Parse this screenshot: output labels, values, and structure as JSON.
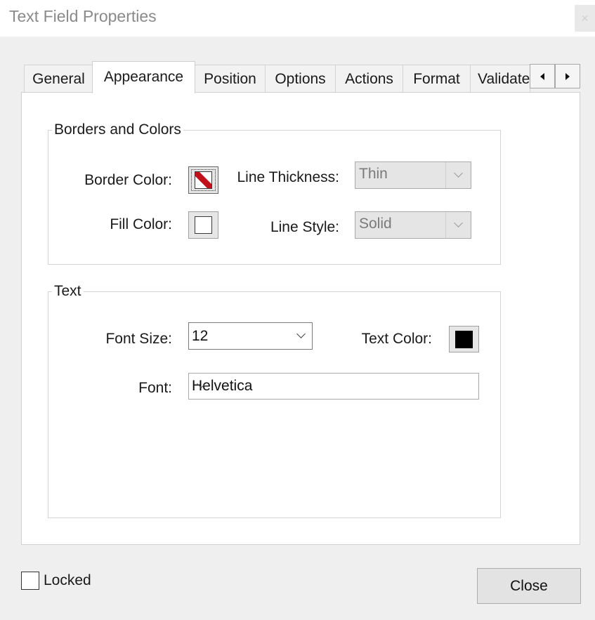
{
  "window": {
    "title": "Text Field Properties"
  },
  "tabs": [
    {
      "label": "General",
      "active": false
    },
    {
      "label": "Appearance",
      "active": true
    },
    {
      "label": "Position",
      "active": false
    },
    {
      "label": "Options",
      "active": false
    },
    {
      "label": "Actions",
      "active": false
    },
    {
      "label": "Format",
      "active": false
    },
    {
      "label": "Validate",
      "active": false
    }
  ],
  "borders_colors": {
    "legend": "Borders and Colors",
    "border_color_label": "Border Color:",
    "fill_color_label": "Fill Color:",
    "line_thickness_label": "Line Thickness:",
    "line_thickness_value": "Thin",
    "line_style_label": "Line Style:",
    "line_style_value": "Solid",
    "border_color": "transparent",
    "fill_color": "transparent"
  },
  "text_group": {
    "legend": "Text",
    "font_size_label": "Font Size:",
    "font_size_value": "12",
    "text_color_label": "Text Color:",
    "text_color": "#000000",
    "font_label": "Font:",
    "font_value": "Helvetica"
  },
  "footer": {
    "locked_label": "Locked",
    "locked_checked": false,
    "close_label": "Close"
  }
}
